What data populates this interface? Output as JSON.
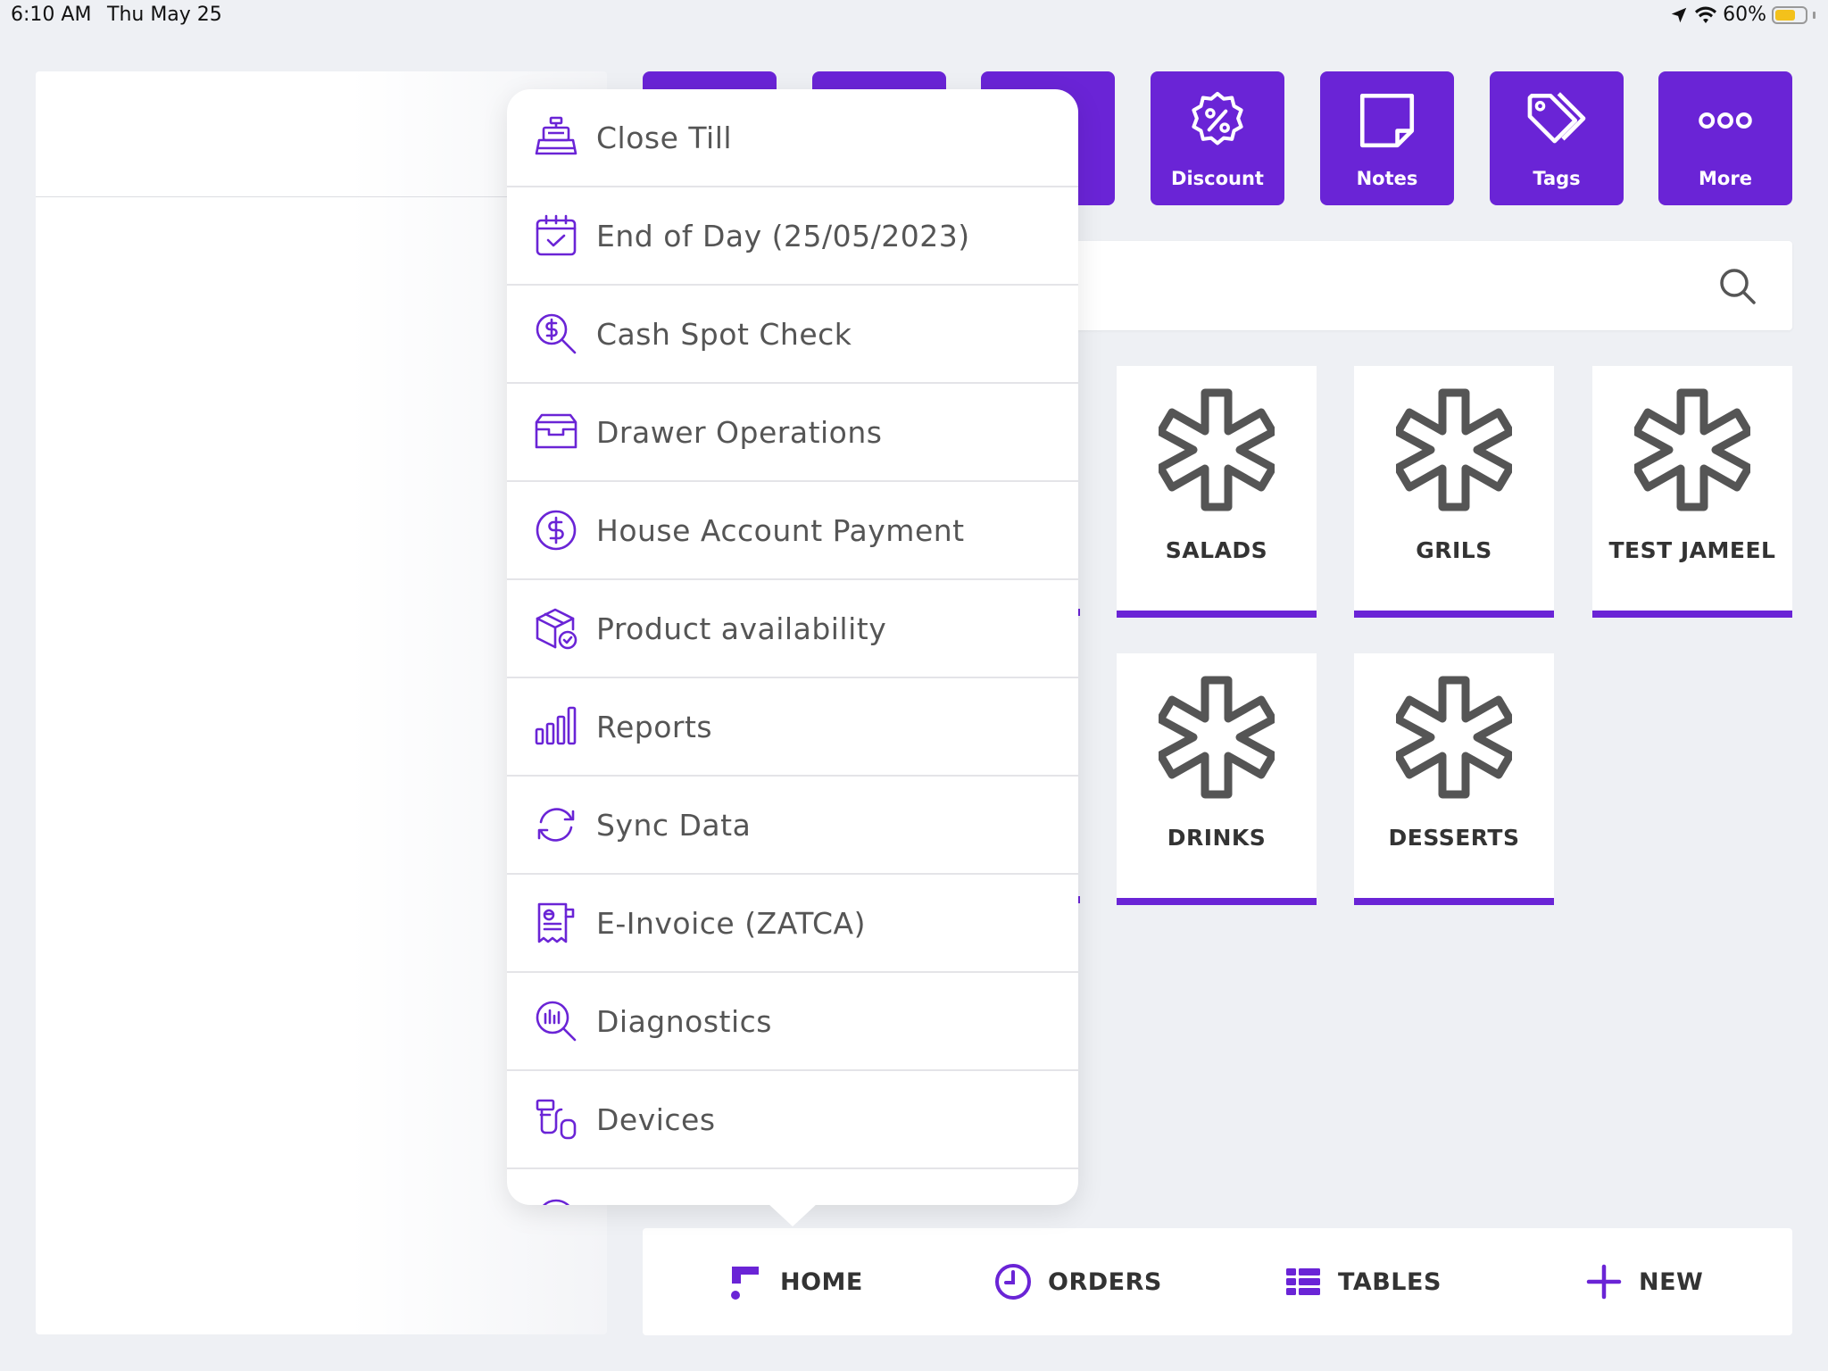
{
  "status_bar": {
    "time": "6:10 AM",
    "date": "Thu May 25",
    "battery": "60%"
  },
  "colors": {
    "accent": "#6a24d6",
    "icon_gray": "#555555",
    "background": "#eef0f4"
  },
  "top_actions": [
    {
      "label": "Discount",
      "icon": "discount-icon"
    },
    {
      "label": "Notes",
      "icon": "notes-icon"
    },
    {
      "label": "Tags",
      "icon": "tags-icon"
    },
    {
      "label": "More",
      "icon": "more-icon"
    }
  ],
  "search": {
    "icon": "search-icon"
  },
  "categories": [
    {
      "label": "SALADS",
      "icon": "asterisk-icon"
    },
    {
      "label": "GRILS",
      "icon": "asterisk-icon"
    },
    {
      "label": "TEST JAMEEL",
      "icon": "asterisk-icon"
    },
    {
      "label": "DRINKS",
      "icon": "asterisk-icon"
    },
    {
      "label": "DESSERTS",
      "icon": "asterisk-icon"
    }
  ],
  "menu": {
    "items": [
      {
        "label": "Close Till",
        "icon": "cash-register-icon"
      },
      {
        "label": "End of Day (25/05/2023)",
        "icon": "calendar-check-icon"
      },
      {
        "label": "Cash Spot Check",
        "icon": "dollar-search-icon"
      },
      {
        "label": "Drawer Operations",
        "icon": "drawer-icon"
      },
      {
        "label": "House Account Payment",
        "icon": "dollar-circle-icon"
      },
      {
        "label": "Product availability",
        "icon": "box-check-icon"
      },
      {
        "label": "Reports",
        "icon": "bar-chart-icon"
      },
      {
        "label": "Sync Data",
        "icon": "sync-icon"
      },
      {
        "label": "E-Invoice (ZATCA)",
        "icon": "e-invoice-icon"
      },
      {
        "label": "Diagnostics",
        "icon": "diagnostics-icon"
      },
      {
        "label": "Devices",
        "icon": "devices-icon"
      }
    ]
  },
  "bottom_nav": [
    {
      "label": "HOME",
      "icon": "home-logo-icon"
    },
    {
      "label": "ORDERS",
      "icon": "clock-icon"
    },
    {
      "label": "TABLES",
      "icon": "tables-icon"
    },
    {
      "label": "NEW",
      "icon": "plus-icon"
    }
  ]
}
